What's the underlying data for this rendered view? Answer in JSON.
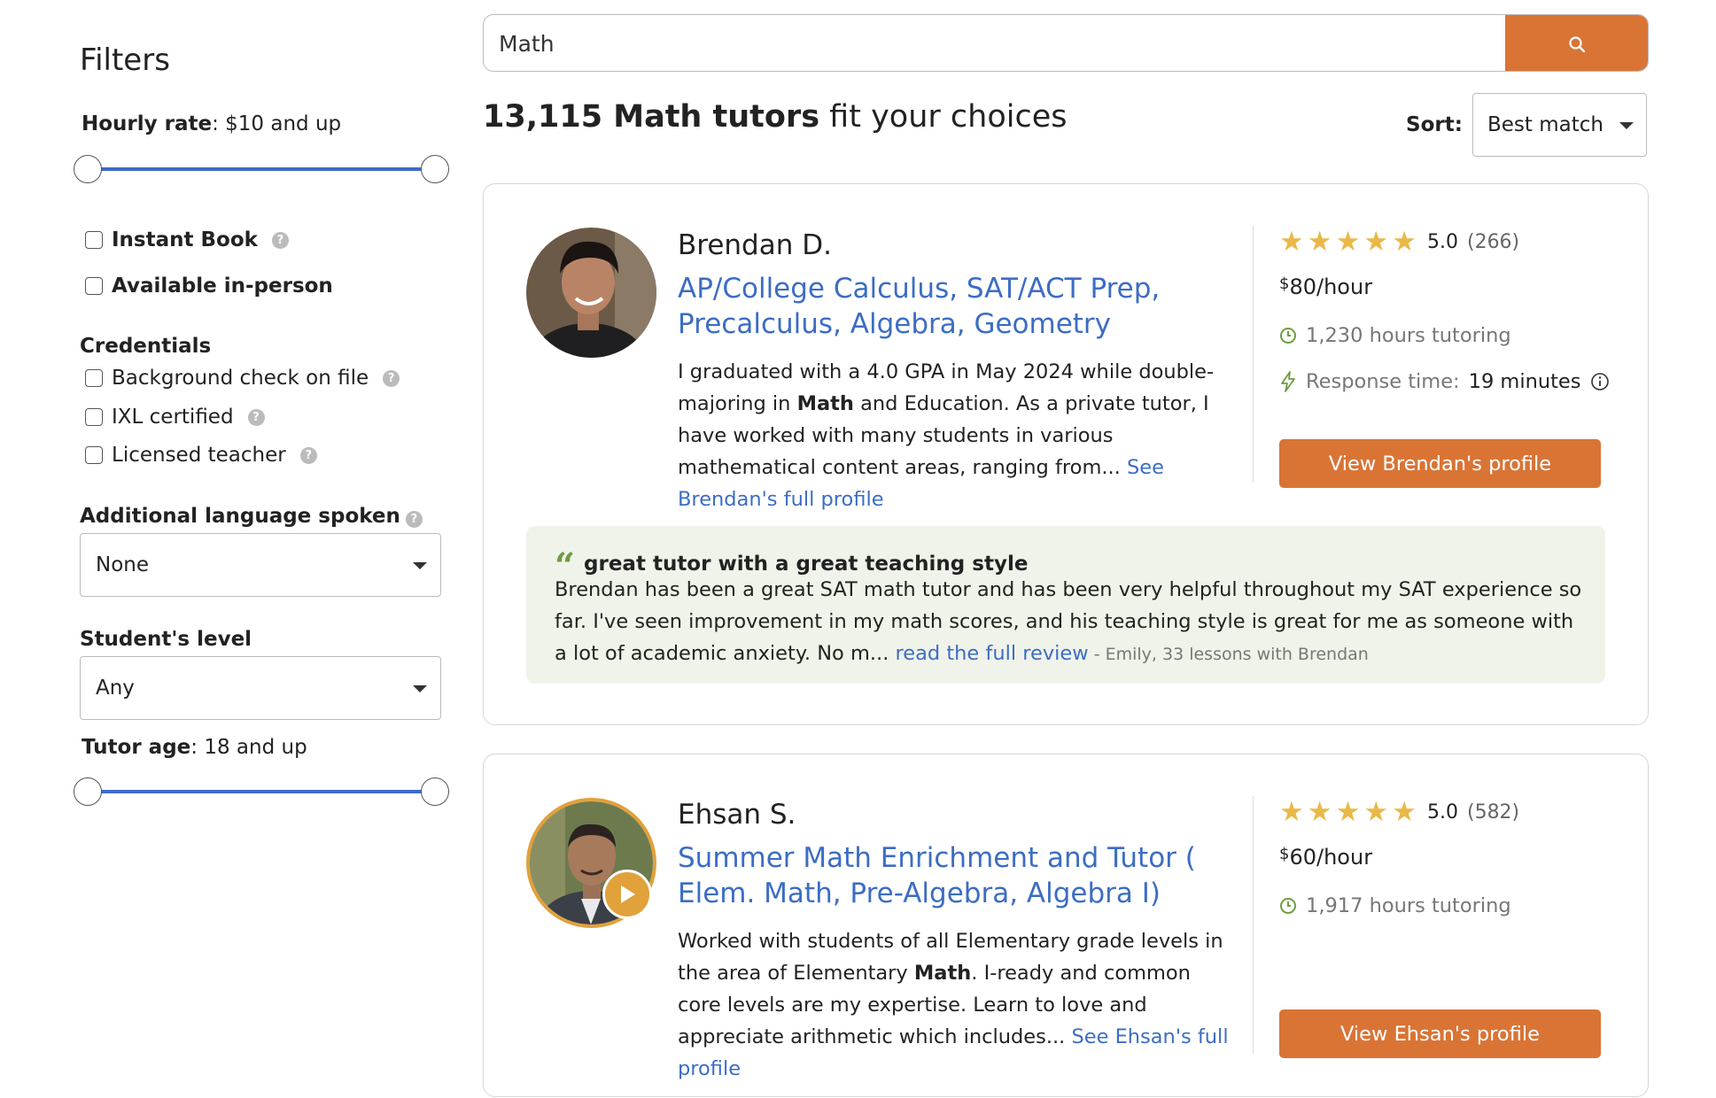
{
  "sidebar": {
    "title": "Filters",
    "hourly_rate": {
      "label": "Hourly rate",
      "value": ": $10 and up",
      "min_fraction": 0,
      "max_fraction": 1
    },
    "checkboxes_top": [
      {
        "label": "Instant Book",
        "checked": false,
        "help": true
      },
      {
        "label": "Available in-person",
        "checked": false,
        "help": false
      }
    ],
    "credentials": {
      "heading": "Credentials",
      "items": [
        {
          "label": "Background check on file",
          "checked": false
        },
        {
          "label": "IXL certified",
          "checked": false
        },
        {
          "label": "Licensed teacher",
          "checked": false
        }
      ]
    },
    "language": {
      "heading": "Additional language spoken",
      "value": "None"
    },
    "level": {
      "heading": "Student's level",
      "value": "Any"
    },
    "tutor_age": {
      "label": "Tutor age",
      "value": ": 18 and up",
      "min_fraction": 0,
      "max_fraction": 1
    }
  },
  "search": {
    "query": "Math",
    "icon": "search-icon"
  },
  "results": {
    "count": "13,115 Math tutors",
    "suffix": " fit your choices"
  },
  "sort": {
    "label": "Sort:",
    "value": "Best match"
  },
  "tutors": [
    {
      "name": "Brendan D.",
      "subjects": "AP/College Calculus, SAT/ACT Prep, Precalculus, Algebra, Geometry",
      "bio_before": "I graduated with a 4.0 GPA in May 2024 while double-majoring in ",
      "bio_bold": "Math",
      "bio_after": " and Education. As a private tutor, I have worked with many students in various mathematical content areas, ranging from... ",
      "bio_link": "See Brendan's full profile",
      "rating": "5.0",
      "review_count": "(266)",
      "price_currency": "$",
      "price_amount": "80",
      "price_unit": "/hour",
      "hours": "1,230 hours tutoring",
      "response_label": "Response time: ",
      "response_value": "19 minutes",
      "button": "View Brendan's profile",
      "review": {
        "title": "great tutor with a great teaching style",
        "text": "Brendan has been a great SAT math tutor and has been very helpful throughout my SAT experience so far. I've seen improvement in my math scores, and his teaching style is great for me as someone with a lot of academic anxiety. No m... ",
        "link": "read the full review",
        "meta": " - Emily, 33 lessons with Brendan"
      }
    },
    {
      "name": "Ehsan S.",
      "subjects": "Summer Math Enrichment and Tutor ( Elem. Math, Pre-Algebra, Algebra I)",
      "bio_before": "Worked with students of all Elementary grade levels in the area of Elementary ",
      "bio_bold": "Math",
      "bio_after": ". I-ready and common core levels are my expertise. Learn to love and appreciate arithmetic which includes... ",
      "bio_link": "See Ehsan's full profile",
      "rating": "5.0",
      "review_count": "(582)",
      "price_currency": "$",
      "price_amount": "60",
      "price_unit": "/hour",
      "hours": "1,917 hours tutoring",
      "button": "View Ehsan's profile"
    }
  ],
  "colors": {
    "accent": "#d97435",
    "link": "#3c6dc4",
    "star": "#e9b848",
    "review_bg": "#f0f3ea",
    "slider": "#3f6ac8"
  }
}
